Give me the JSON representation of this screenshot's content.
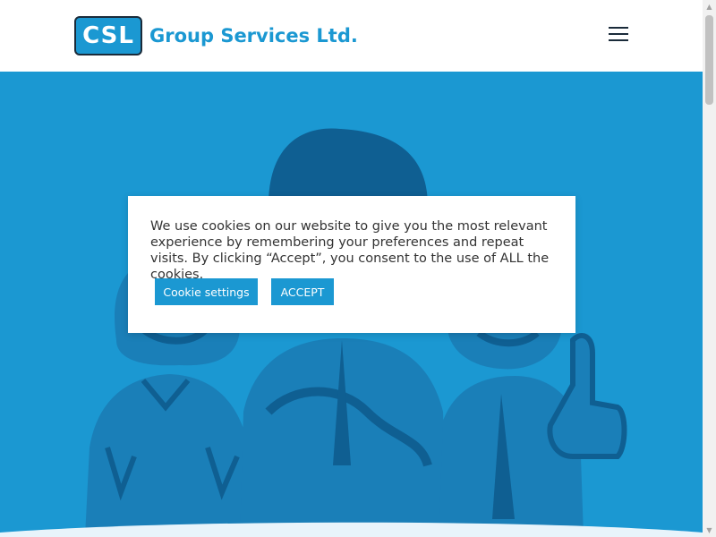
{
  "header": {
    "logo_mark": "CSL",
    "logo_text": "Group Services Ltd."
  },
  "menu_icon": "hamburger-menu-icon",
  "hero": {
    "background_color": "#1b98d2",
    "illustration": "people-illustration"
  },
  "cookie_notice": {
    "message": "We use cookies on our website to give you the most relevant experience by remembering your preferences and repeat visits. By clicking “Accept”, you consent to the use of ALL the cookies.",
    "settings_label": "Cookie settings",
    "accept_label": "ACCEPT"
  },
  "colors": {
    "brand": "#1b98d2",
    "illustration_dark": "#0f5f92",
    "illustration_mid": "#1a7fb8"
  }
}
